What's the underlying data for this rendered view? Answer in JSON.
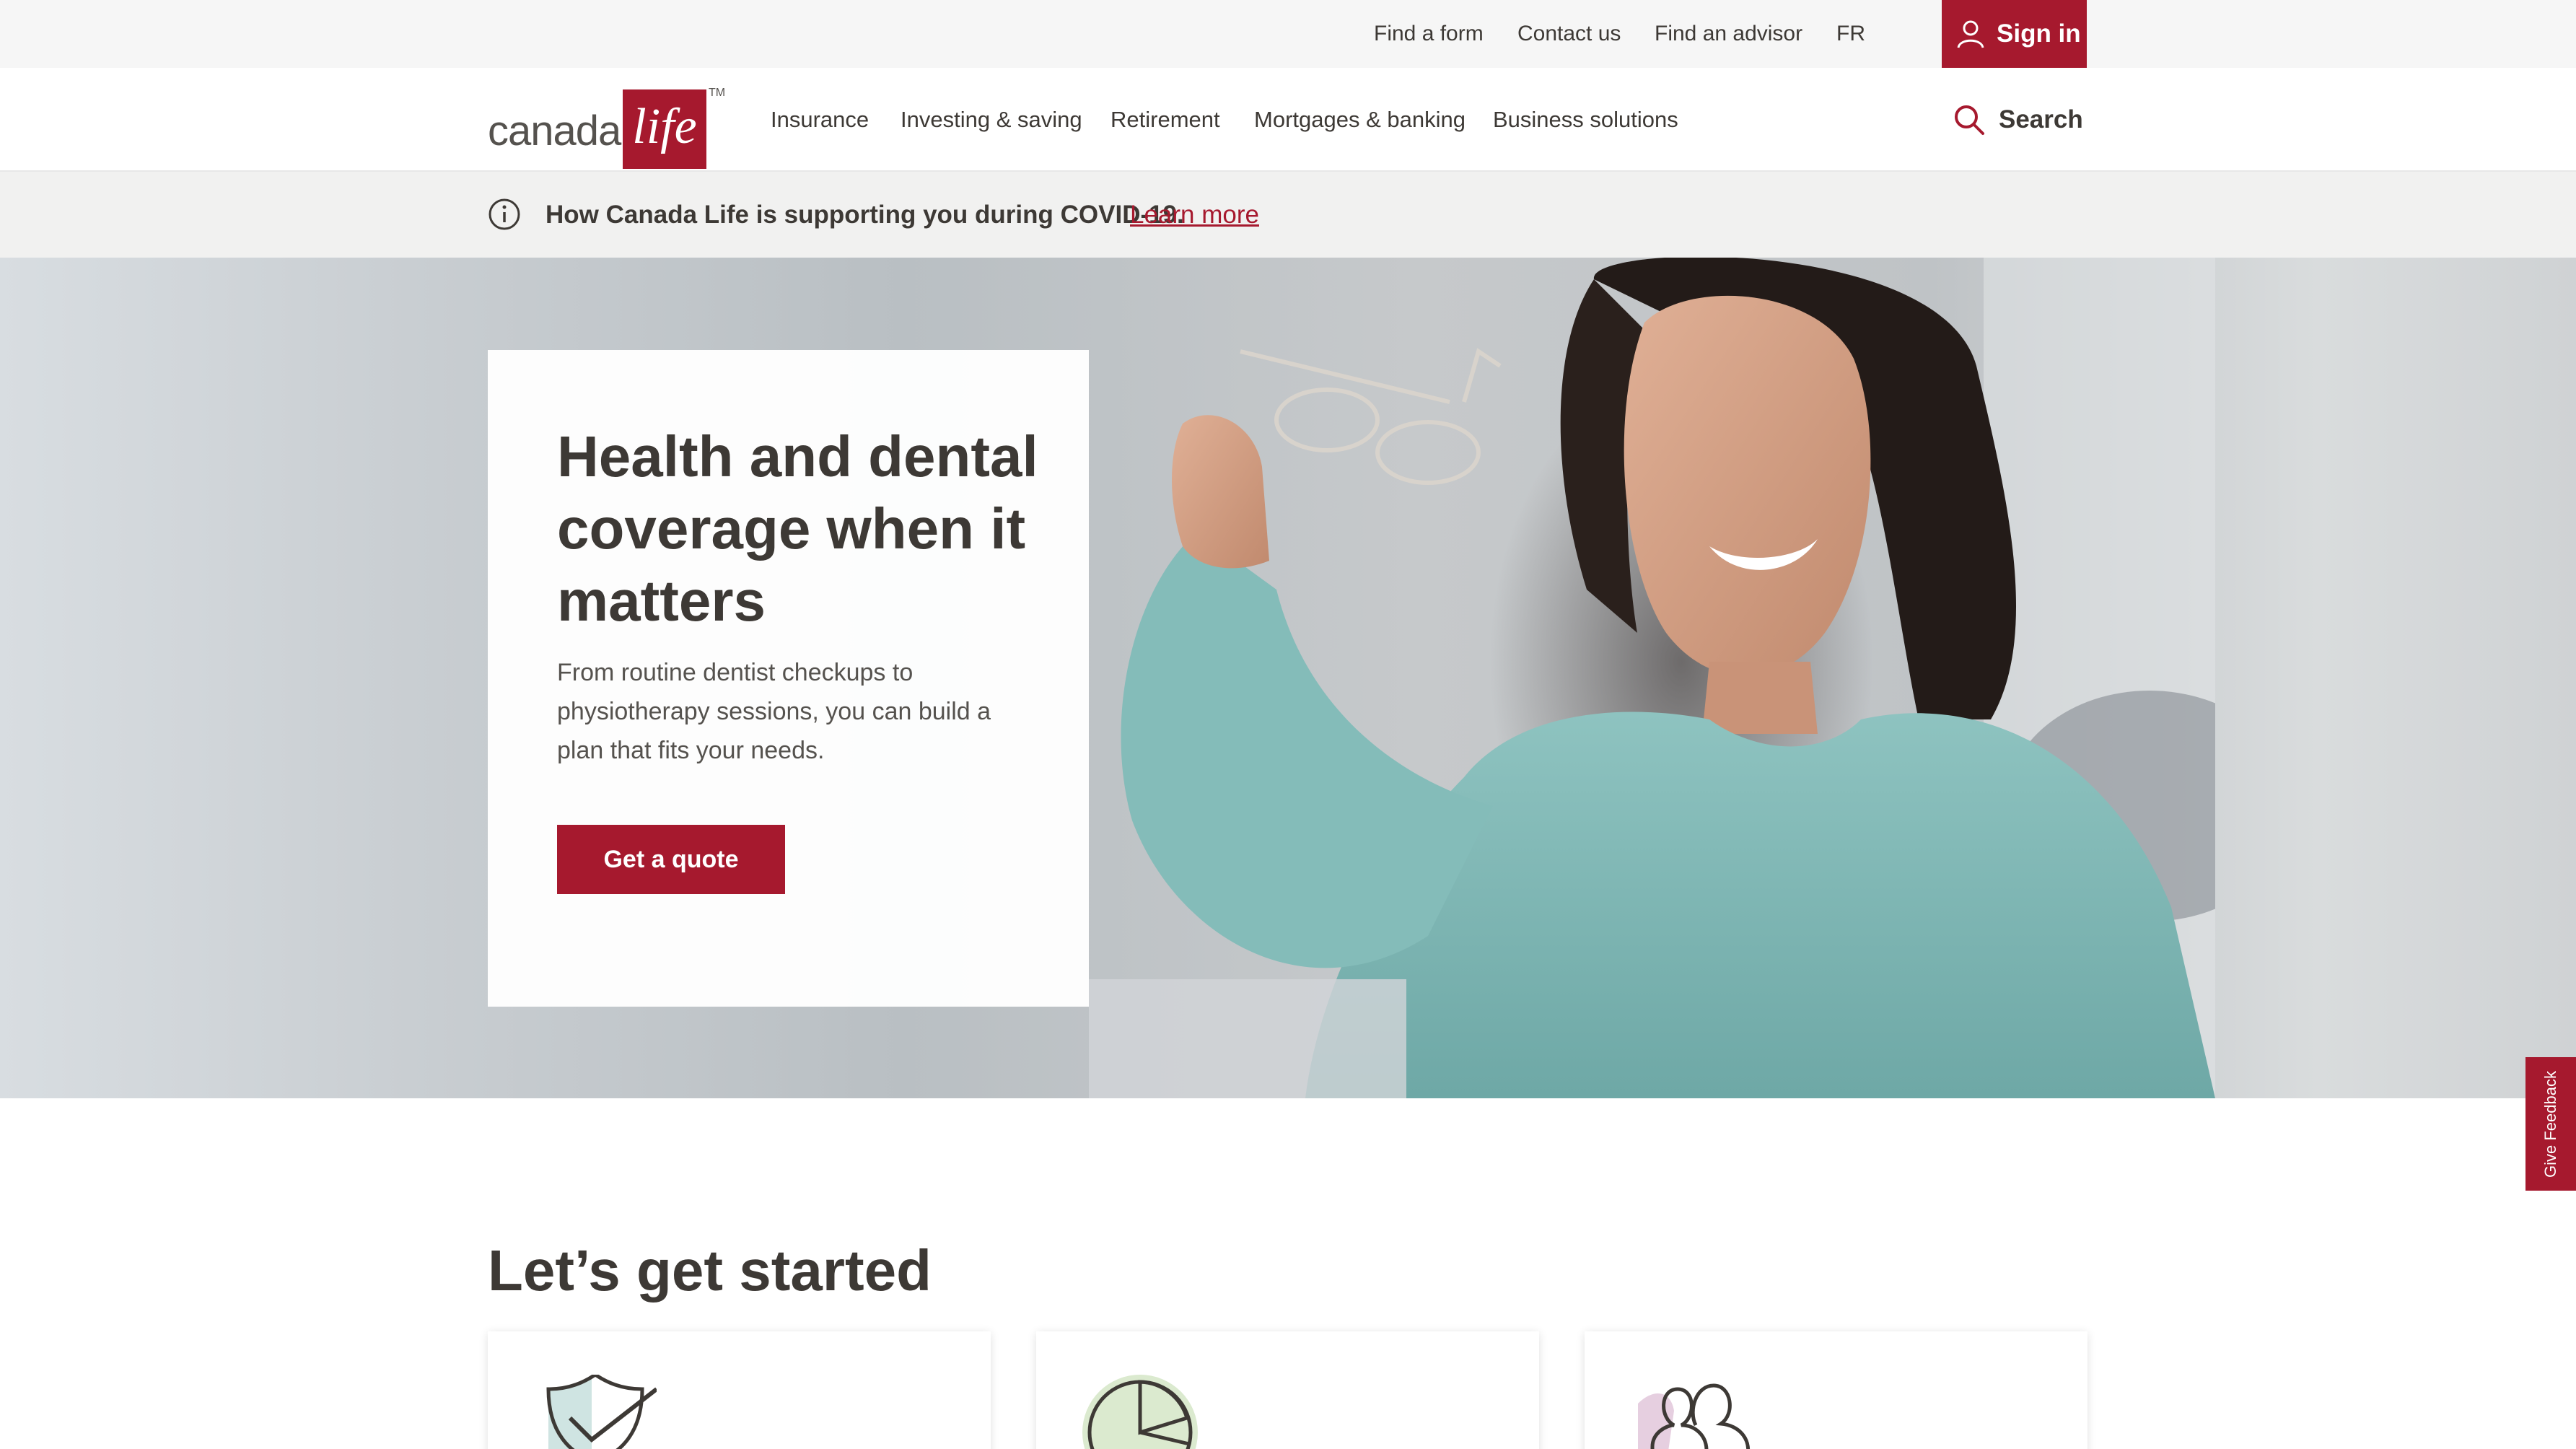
{
  "utility_bar": {
    "links": [
      "Find a form",
      "Contact us",
      "Find an advisor",
      "FR"
    ],
    "sign_in": "Sign in"
  },
  "header": {
    "logo": {
      "word": "canada",
      "box_text": "life",
      "tm": "TM"
    },
    "nav": [
      "Insurance",
      "Investing & saving",
      "Retirement",
      "Mortgages & banking",
      "Business solutions"
    ],
    "search_label": "Search"
  },
  "alert": {
    "text": "How Canada Life is supporting you during COVID-19.",
    "link": "Learn more"
  },
  "hero": {
    "title": "Health and dental coverage when it matters",
    "description": "From routine dentist checkups to physiotherapy sessions, you can build a plan that fits your needs.",
    "cta": "Get a quote"
  },
  "feedback_tab": "Give Feedback",
  "get_started": {
    "title": "Let’s get started",
    "cards": [
      {
        "icon": "shield-check-icon"
      },
      {
        "icon": "pie-chart-icon"
      },
      {
        "icon": "people-icon"
      }
    ]
  },
  "colors": {
    "brand": "#a6192e",
    "text": "#3d3935",
    "accent_green": "#9cc28a"
  }
}
